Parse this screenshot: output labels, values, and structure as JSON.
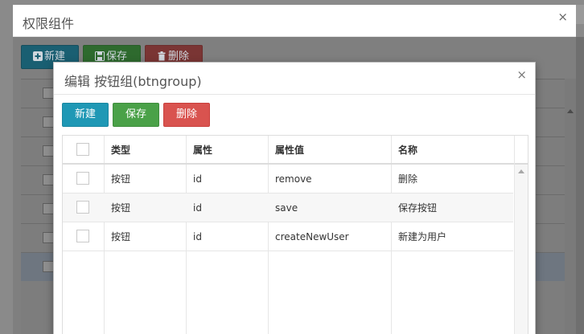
{
  "outer_dialog": {
    "title": "权限组件",
    "close": "×",
    "toolbar": {
      "new_label": "新建",
      "save_label": "保存",
      "delete_label": "删除"
    }
  },
  "inner_dialog": {
    "title": "编辑 按钮组(btngroup)",
    "close": "×",
    "toolbar": {
      "new_label": "新建",
      "save_label": "保存",
      "delete_label": "删除"
    },
    "table": {
      "headers": [
        "类型",
        "属性",
        "属性值",
        "名称"
      ],
      "rows": [
        [
          "按钮",
          "id",
          "remove",
          "删除"
        ],
        [
          "按钮",
          "id",
          "save",
          "保存按钮"
        ],
        [
          "按钮",
          "id",
          "createNewUser",
          "新建为用户"
        ]
      ]
    }
  },
  "colors": {
    "info": "#1f98b5",
    "success": "#4aa148",
    "danger": "#d9534f"
  }
}
